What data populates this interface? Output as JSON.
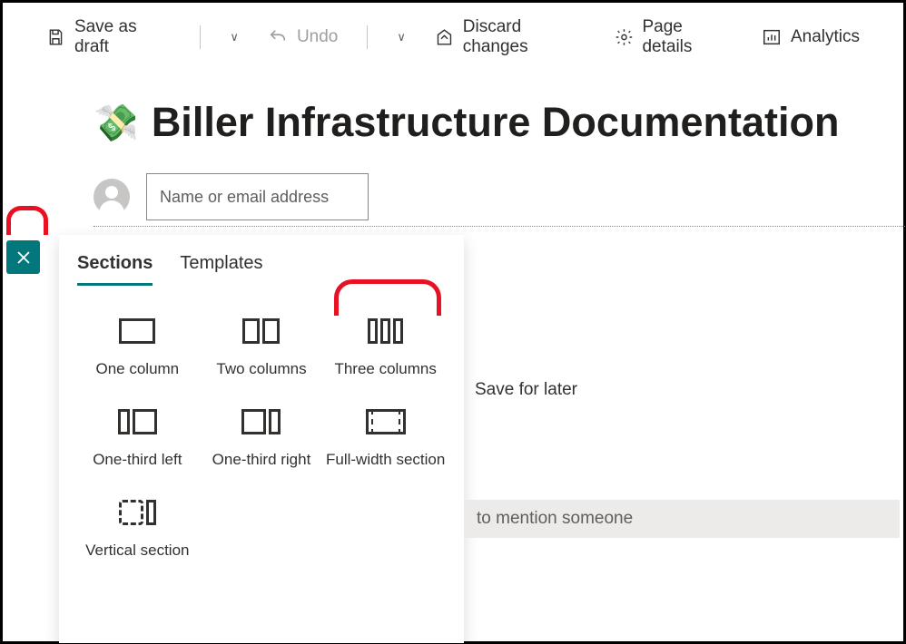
{
  "toolbar": {
    "save_draft": "Save as draft",
    "undo": "Undo",
    "discard": "Discard changes",
    "page_details": "Page details",
    "analytics": "Analytics"
  },
  "page": {
    "emoji": "💸",
    "title": "Biller Infrastructure Documentation",
    "name_placeholder": "Name or email address"
  },
  "panel": {
    "tabs": {
      "sections": "Sections",
      "templates": "Templates"
    },
    "options": {
      "one_column": "One column",
      "two_columns": "Two columns",
      "three_columns": "Three columns",
      "one_third_left": "One-third left",
      "one_third_right": "One-third right",
      "full_width": "Full-width section",
      "vertical": "Vertical section"
    }
  },
  "body": {
    "save_later": "Save for later",
    "mention": "to mention someone"
  }
}
